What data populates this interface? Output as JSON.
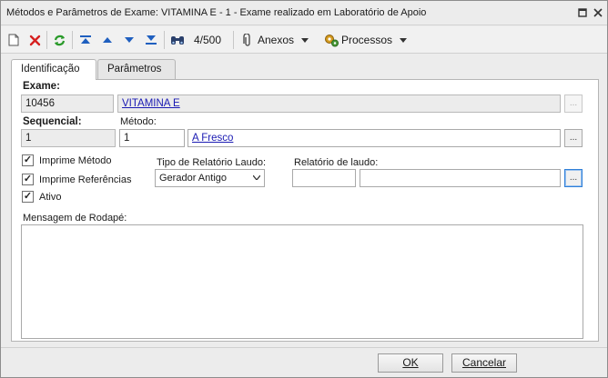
{
  "window": {
    "title": "Métodos e Parâmetros de Exame: VITAMINA E - 1 - Exame realizado em Laboratório de Apoio",
    "restore_icon": "restore-icon",
    "close_icon": "close-icon"
  },
  "toolbar": {
    "record_counter": "4/500",
    "anexos_label": "Anexos",
    "processos_label": "Processos",
    "icons": [
      "new-document-icon",
      "delete-icon",
      "refresh-icon",
      "first-record-icon",
      "previous-record-icon",
      "next-record-icon",
      "last-record-icon",
      "binoculars-icon",
      "paperclip-icon",
      "gears-icon"
    ]
  },
  "tabs": [
    {
      "label": "Identificação",
      "active": true
    },
    {
      "label": "Parâmetros",
      "active": false
    }
  ],
  "form": {
    "exame_label": "Exame:",
    "exame_code": "10456",
    "exame_name": "VITAMINA E",
    "sequencial_label": "Sequencial:",
    "sequencial_value": "1",
    "metodo_label": "Método:",
    "metodo_code": "1",
    "metodo_name": "A Fresco",
    "ellipsis": "...",
    "checkboxes": [
      {
        "label": "Imprime Método",
        "checked": true
      },
      {
        "label": "Imprime Referências",
        "checked": true
      },
      {
        "label": "Ativo",
        "checked": true
      }
    ],
    "check_mark": "✓",
    "tipo_relatorio_label": "Tipo de Relatório Laudo:",
    "tipo_relatorio_value": "Gerador Antigo",
    "relatorio_laudo_label": "Relatório de laudo:",
    "relatorio_laudo_code": "",
    "relatorio_laudo_name": "",
    "mensagem_rodape_label": "Mensagem de Rodapé:",
    "mensagem_rodape_value": ""
  },
  "footer": {
    "ok_label": "OK",
    "cancel_label": "Cancelar"
  },
  "colors": {
    "link": "#1a1ab3",
    "delete_red": "#d62020",
    "refresh_green": "#2a9a2a",
    "nav_blue": "#1f5fbf",
    "focus_blue": "#2f7fd8"
  }
}
